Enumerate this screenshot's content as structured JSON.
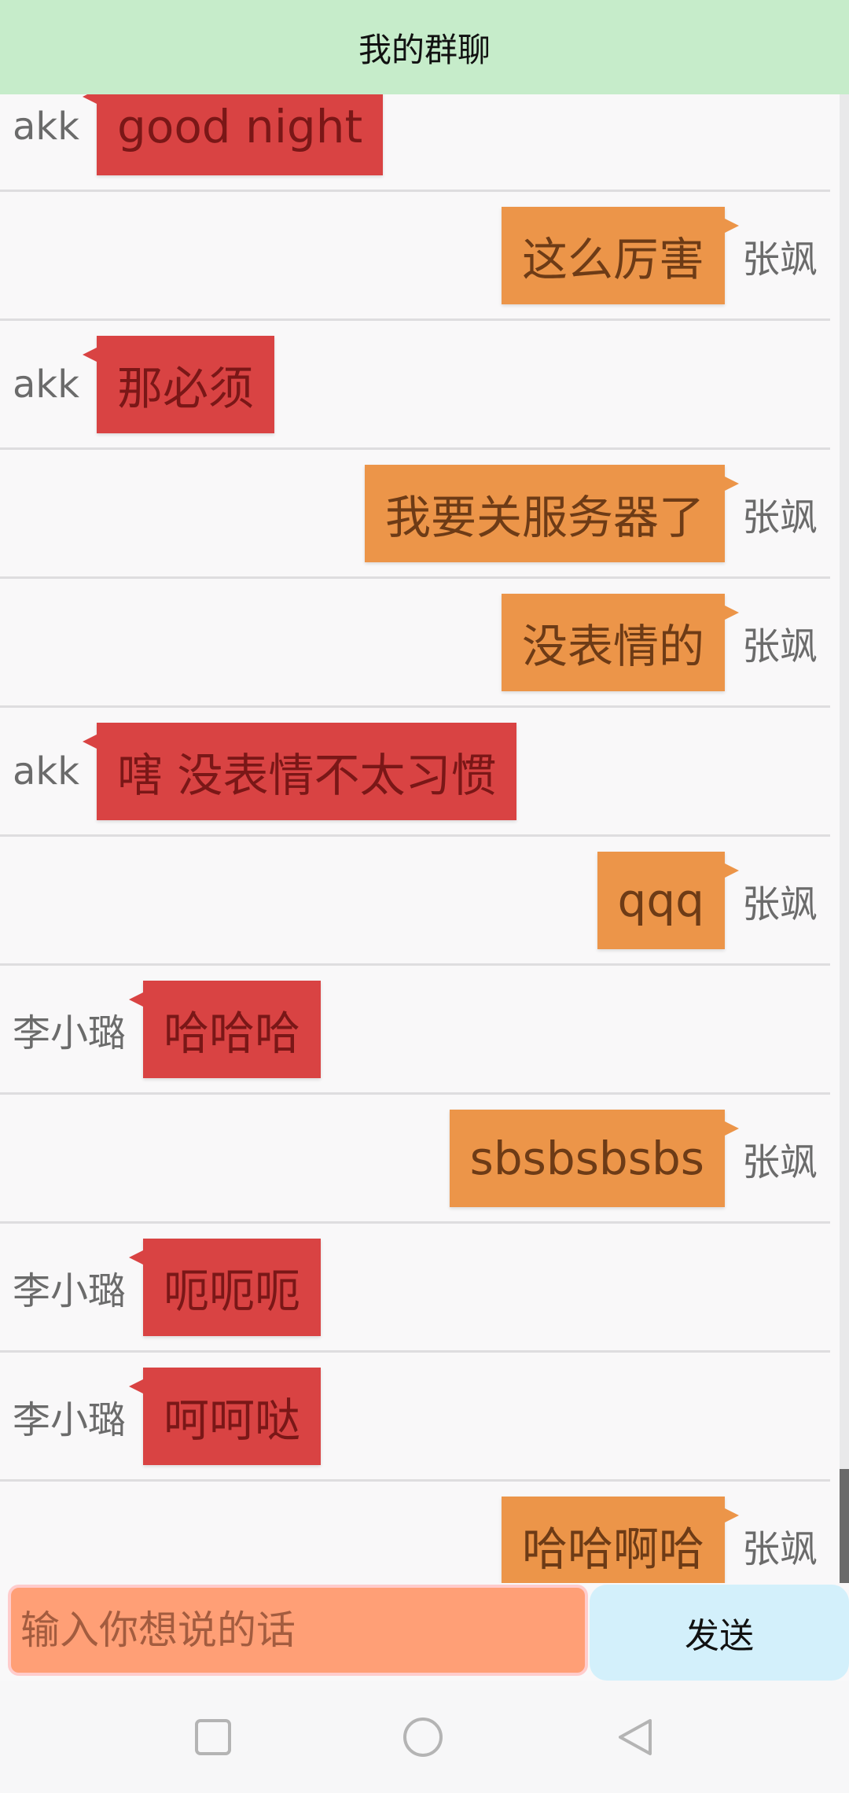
{
  "header": {
    "title": "我的群聊"
  },
  "messages": [
    {
      "side": "left",
      "sender": "akk",
      "text": "good night",
      "color": "#d94343"
    },
    {
      "side": "right",
      "sender": "张飒",
      "text": "这么厉害",
      "color": "#ec9549"
    },
    {
      "side": "left",
      "sender": "akk",
      "text": "那必须",
      "color": "#d94343"
    },
    {
      "side": "right",
      "sender": "张飒",
      "text": "我要关服务器了",
      "color": "#ec9549"
    },
    {
      "side": "right",
      "sender": "张飒",
      "text": "没表情的",
      "color": "#ec9549"
    },
    {
      "side": "left",
      "sender": "akk",
      "text": "嗐 没表情不太习惯",
      "color": "#d94343"
    },
    {
      "side": "right",
      "sender": "张飒",
      "text": "qqq",
      "color": "#ec9549"
    },
    {
      "side": "left",
      "sender": "李小璐",
      "text": "哈哈哈",
      "color": "#d94343"
    },
    {
      "side": "right",
      "sender": "张飒",
      "text": "sbsbsbsbs",
      "color": "#ec9549"
    },
    {
      "side": "left",
      "sender": "李小璐",
      "text": "呃呃呃",
      "color": "#d94343"
    },
    {
      "side": "left",
      "sender": "李小璐",
      "text": "呵呵哒",
      "color": "#d94343"
    },
    {
      "side": "right",
      "sender": "张飒",
      "text": "哈哈啊哈",
      "color": "#ec9549"
    }
  ],
  "input": {
    "placeholder": "输入你想说的话",
    "value": ""
  },
  "send_button": {
    "label": "发送"
  },
  "navbar": {
    "icons": [
      "square-recents-icon",
      "circle-home-icon",
      "triangle-back-icon"
    ]
  },
  "colors": {
    "header_bg": "#c6ecca",
    "left_bubble": "#d94343",
    "right_bubble": "#ec9549",
    "input_bg": "#ff9f76",
    "send_bg": "#d3f0fb"
  }
}
